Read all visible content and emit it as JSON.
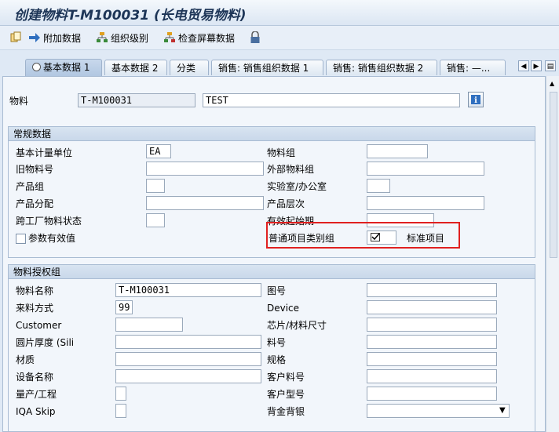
{
  "window": {
    "title": "创建物料T-M100031 (长电贸易物料)"
  },
  "toolbar": {
    "additional_data": "附加数据",
    "org_levels": "组织级别",
    "check_screen_data": "检查屏幕数据"
  },
  "tabs": [
    {
      "label": "基本数据 1",
      "active": true
    },
    {
      "label": "基本数据 2"
    },
    {
      "label": "分类"
    },
    {
      "label": "销售: 销售组织数据 1"
    },
    {
      "label": "销售: 销售组织数据 2"
    },
    {
      "label": "销售: —..."
    }
  ],
  "header": {
    "material_label": "物料",
    "material_value": "T-M100031",
    "description_value": "TEST"
  },
  "general": {
    "title": "常规数据",
    "base_uom_label": "基本计量单位",
    "base_uom_value": "EA",
    "material_group_label": "物料组",
    "old_material_label": "旧物料号",
    "ext_material_group_label": "外部物料组",
    "division_label": "产品组",
    "lab_office_label": "实验室/办公室",
    "product_alloc_label": "产品分配",
    "prod_hierarchy_label": "产品层次",
    "cross_plant_status_label": "跨工厂物料状态",
    "valid_from_label": "有效起始期",
    "param_effectivity_label": "参数有效值",
    "item_cat_group_label": "普通项目类别组",
    "item_cat_group_value": "",
    "item_cat_group_desc": "标准项目"
  },
  "auth": {
    "title": "物料授权组",
    "name_label": "物料名称",
    "name_value": "T-M100031",
    "drawing_label": "图号",
    "source_label": "来料方式",
    "source_value": "99",
    "device_label": "Device",
    "customer_label": "Customer",
    "chip_size_label": "芯片/材料尺寸",
    "wafer_thickness_label": "圆片厚度 (Sili",
    "part_no_label": "料号",
    "material_quality_label": "材质",
    "spec_label": "规格",
    "equipment_name_label": "设备名称",
    "customer_part_label": "客户料号",
    "mass_prod_label": "量产/工程",
    "customer_model_label": "客户型号",
    "iqa_skip_label": "IQA Skip",
    "back_gold_label": "背金背银"
  },
  "colors": {
    "highlight": "#e02020",
    "header_bg": "#c9d8ea"
  }
}
